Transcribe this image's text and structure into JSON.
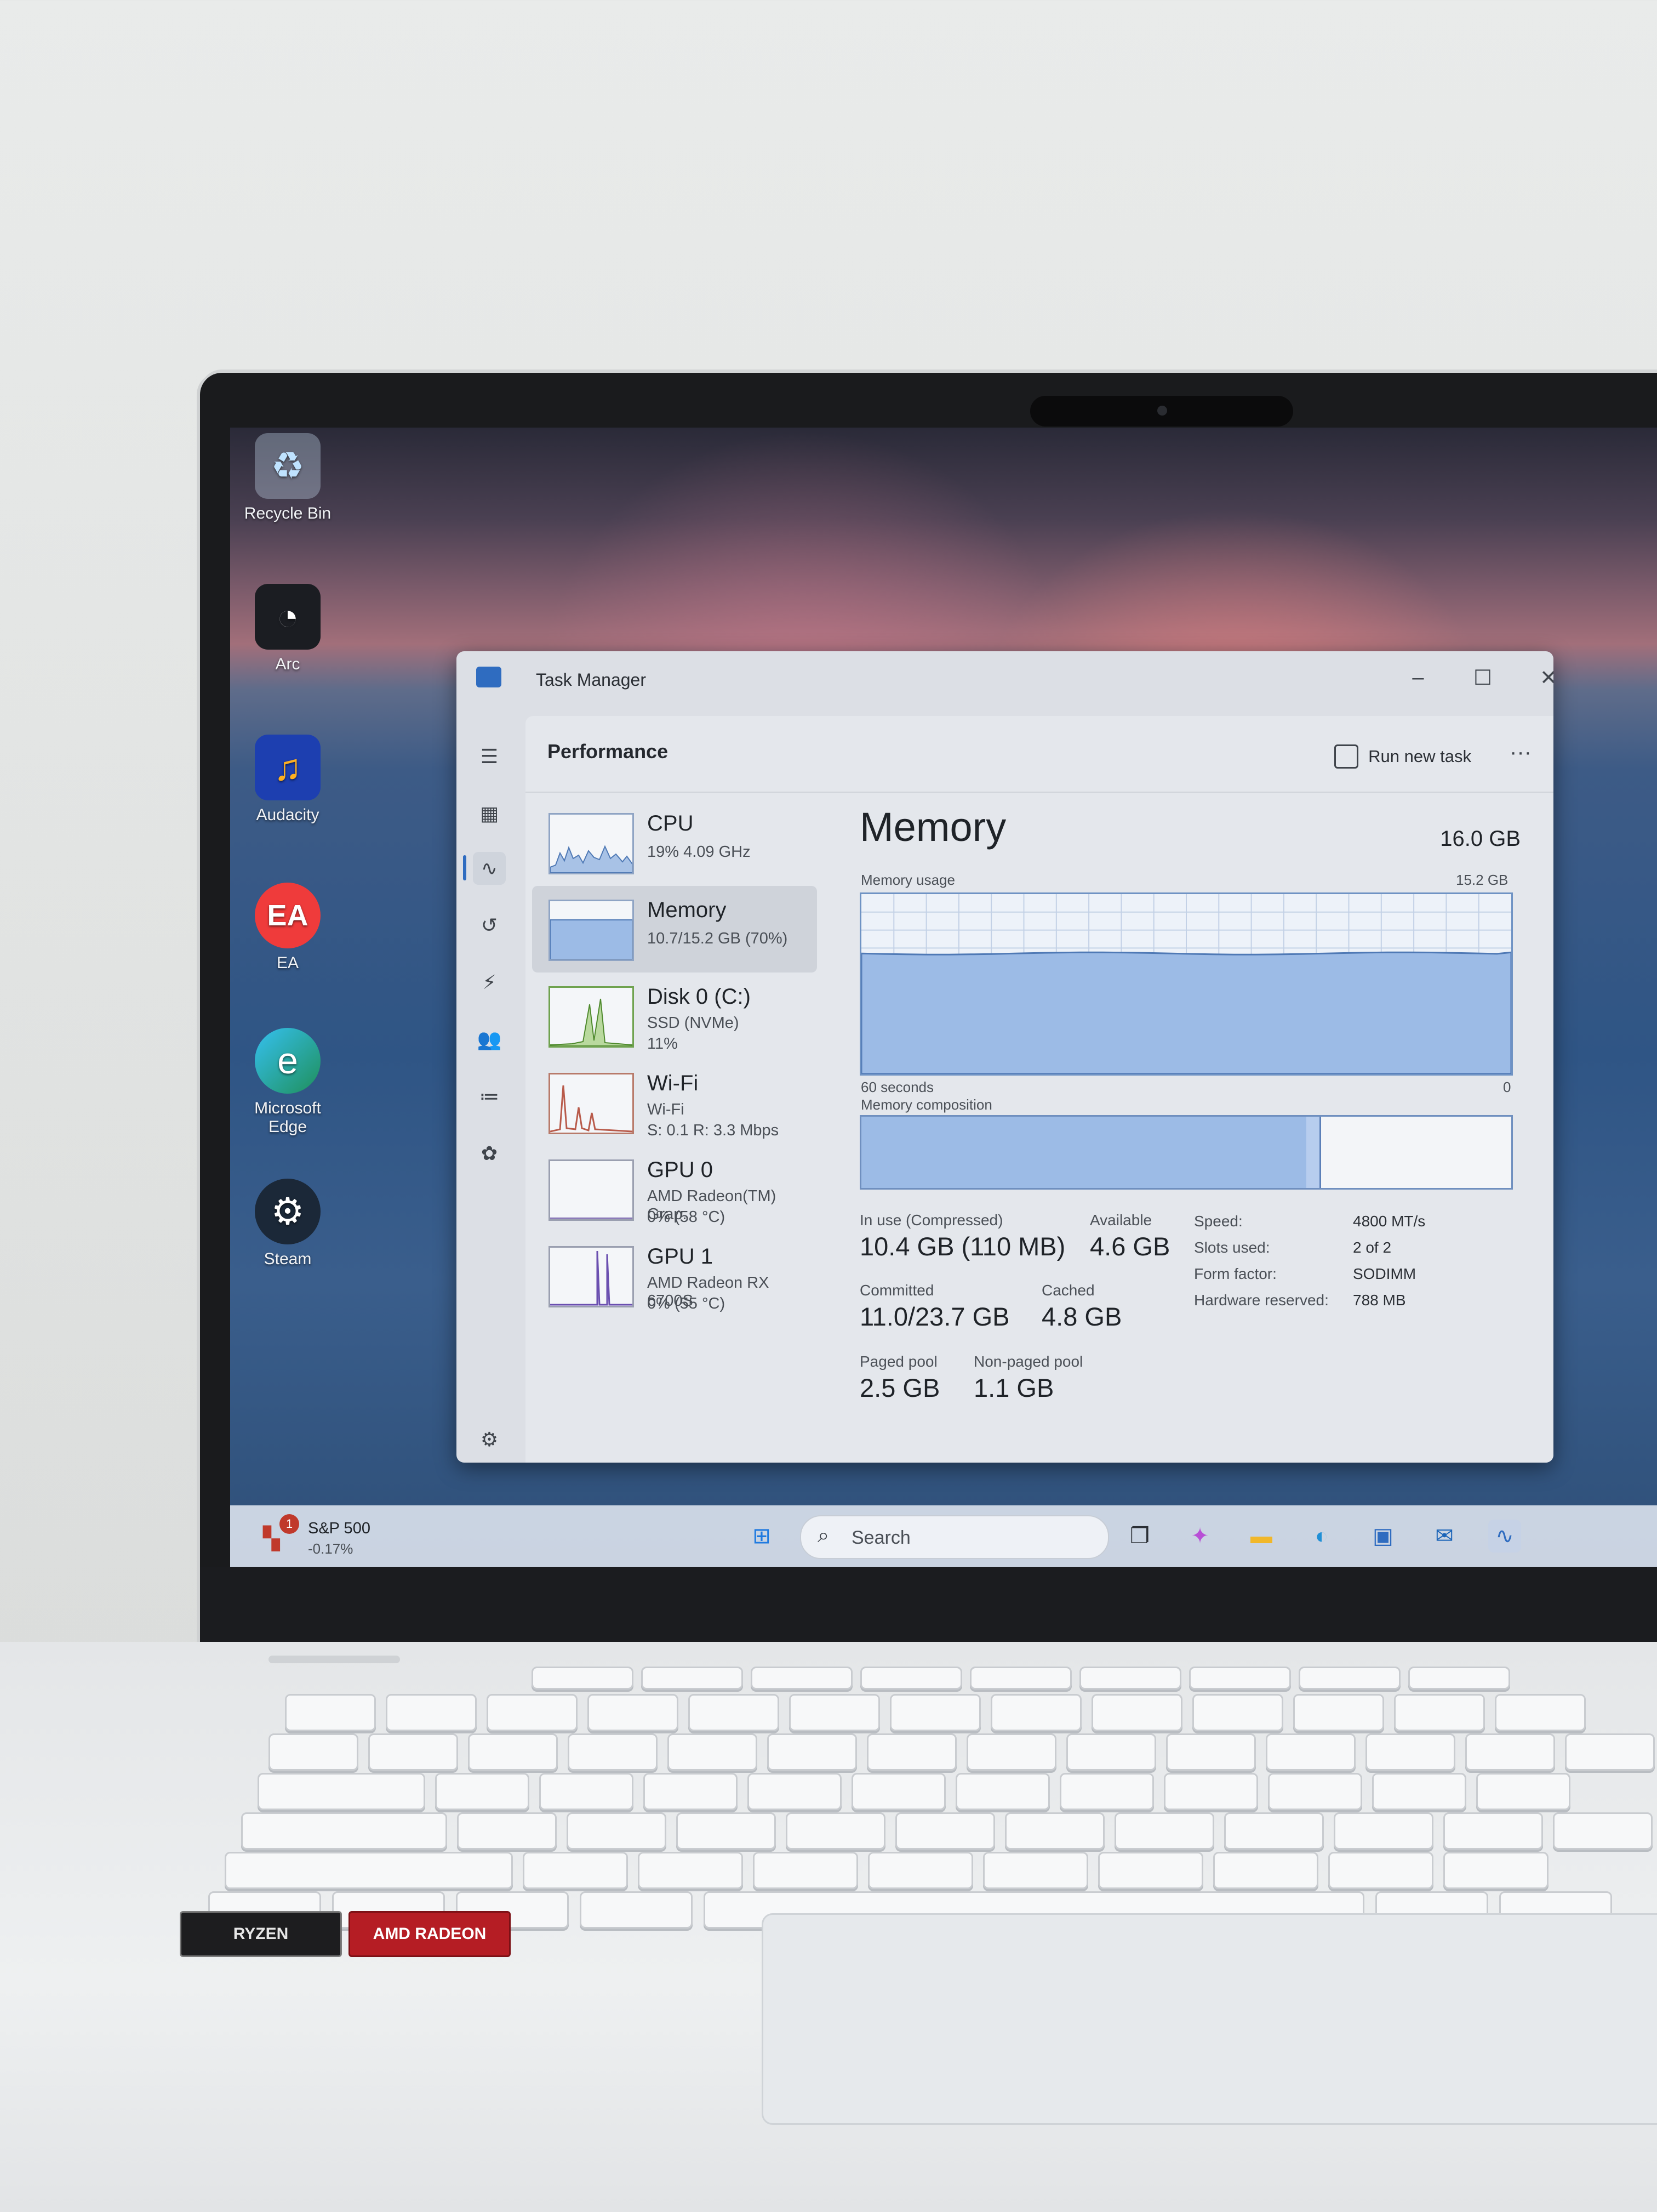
{
  "desktop": {
    "icons": [
      {
        "label": "Recycle Bin",
        "icon": "recycle-bin-icon"
      },
      {
        "label": "Arc",
        "icon": "arc-browser-icon"
      },
      {
        "label": "Audacity",
        "icon": "audacity-icon"
      },
      {
        "label": "EA",
        "icon": "ea-icon"
      },
      {
        "label": "Microsoft Edge",
        "icon": "edge-icon"
      },
      {
        "label": "Steam",
        "icon": "steam-icon"
      }
    ]
  },
  "task_manager": {
    "window_title": "Task Manager",
    "section": "Performance",
    "run_new_task": "Run new task",
    "more": "···",
    "perf_items": [
      {
        "name": "CPU",
        "sub1": "19% 4.09 GHz"
      },
      {
        "name": "Memory",
        "sub1": "10.7/15.2 GB (70%)"
      },
      {
        "name": "Disk 0 (C:)",
        "sub1": "SSD (NVMe)",
        "sub2": "11%"
      },
      {
        "name": "Wi-Fi",
        "sub1": "Wi-Fi",
        "sub2": "S: 0.1 R: 3.3 Mbps"
      },
      {
        "name": "GPU 0",
        "sub1": "AMD Radeon(TM) Grap.",
        "sub2": "0% (58 °C)"
      },
      {
        "name": "GPU 1",
        "sub1": "AMD Radeon RX 6700S",
        "sub2": "0% (55 °C)"
      }
    ],
    "detail": {
      "title": "Memory",
      "total": "16.0 GB",
      "usage_label": "Memory usage",
      "usage_max": "15.2 GB",
      "time_left": "60 seconds",
      "time_right": "0",
      "composition_label": "Memory composition",
      "usage_fraction": 0.67,
      "composition": {
        "in_use_fraction": 0.685,
        "modified_fraction": 0.02
      },
      "stats": {
        "in_use_label": "In use (Compressed)",
        "in_use": "10.4 GB (110 MB)",
        "available_label": "Available",
        "available": "4.6 GB",
        "committed_label": "Committed",
        "committed": "11.0/23.7 GB",
        "cached_label": "Cached",
        "cached": "4.8 GB",
        "paged_label": "Paged pool",
        "paged": "2.5 GB",
        "nonpaged_label": "Non-paged pool",
        "nonpaged": "1.1 GB"
      },
      "specs": [
        {
          "k": "Speed:",
          "v": "4800 MT/s"
        },
        {
          "k": "Slots used:",
          "v": "2 of 2"
        },
        {
          "k": "Form factor:",
          "v": "SODIMM"
        },
        {
          "k": "Hardware reserved:",
          "v": "788 MB"
        }
      ]
    }
  },
  "taskbar": {
    "widget_title": "S&P 500",
    "widget_value": "-0.17%",
    "widget_badge": "1",
    "search_placeholder": "Search"
  },
  "stickers": {
    "ryzen": "RYZEN",
    "radeon": "AMD RADEON"
  },
  "colors": {
    "accent": "#2f6cc0",
    "memory_fill": "#9cbbe6",
    "memory_line": "#5b7fb8"
  }
}
